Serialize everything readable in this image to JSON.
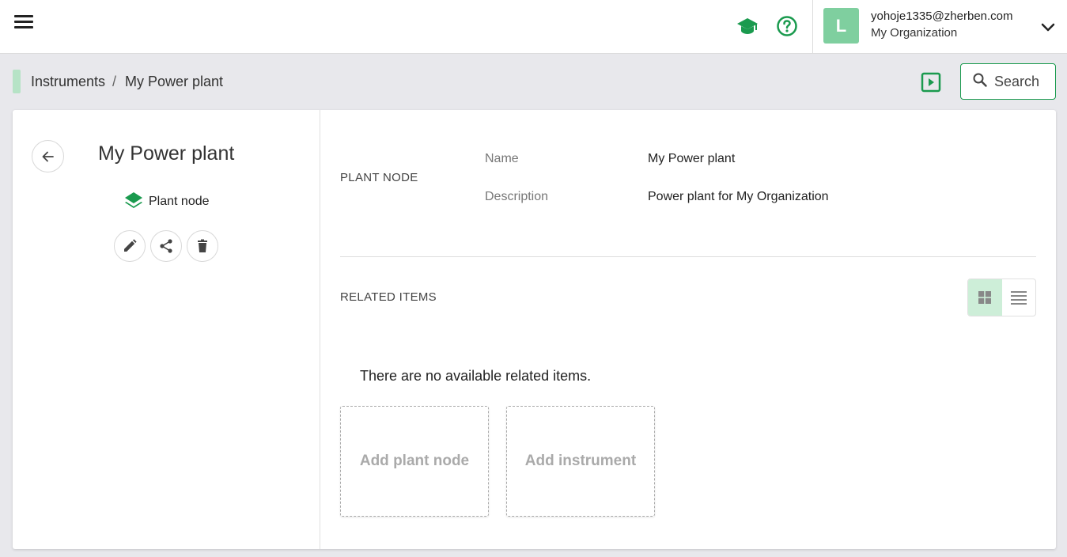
{
  "topbar": {
    "menu_icon": "hamburger-menu-icon",
    "learn_icon": "graduation-cap-icon",
    "help_icon": "help-circle-icon",
    "avatar_initial": "L",
    "user_email": "yohoje1335@zherben.com",
    "user_org": "My Organization",
    "chevron_icon": "chevron-down-icon"
  },
  "breadcrumb": {
    "items": [
      "Instruments",
      "My Power plant"
    ],
    "separator": "/"
  },
  "toolbar": {
    "present_icon": "play-square-icon",
    "search_label": "Search"
  },
  "node": {
    "title": "My Power plant",
    "type_label": "Plant node",
    "type_icon": "layers-icon",
    "actions": [
      "edit-icon",
      "share-icon",
      "delete-icon"
    ]
  },
  "details": {
    "section_label": "PLANT NODE",
    "fields": [
      {
        "label": "Name",
        "value": "My Power plant"
      },
      {
        "label": "Description",
        "value": "Power plant for My Organization"
      }
    ]
  },
  "related": {
    "section_label": "RELATED ITEMS",
    "empty_message": "There are no available related items.",
    "add_cards": [
      "Add plant node",
      "Add instrument"
    ]
  },
  "colors": {
    "accent_green": "#1a9a4e",
    "avatar_bg": "#7fcf9f",
    "toggle_active": "#cdeed8"
  }
}
